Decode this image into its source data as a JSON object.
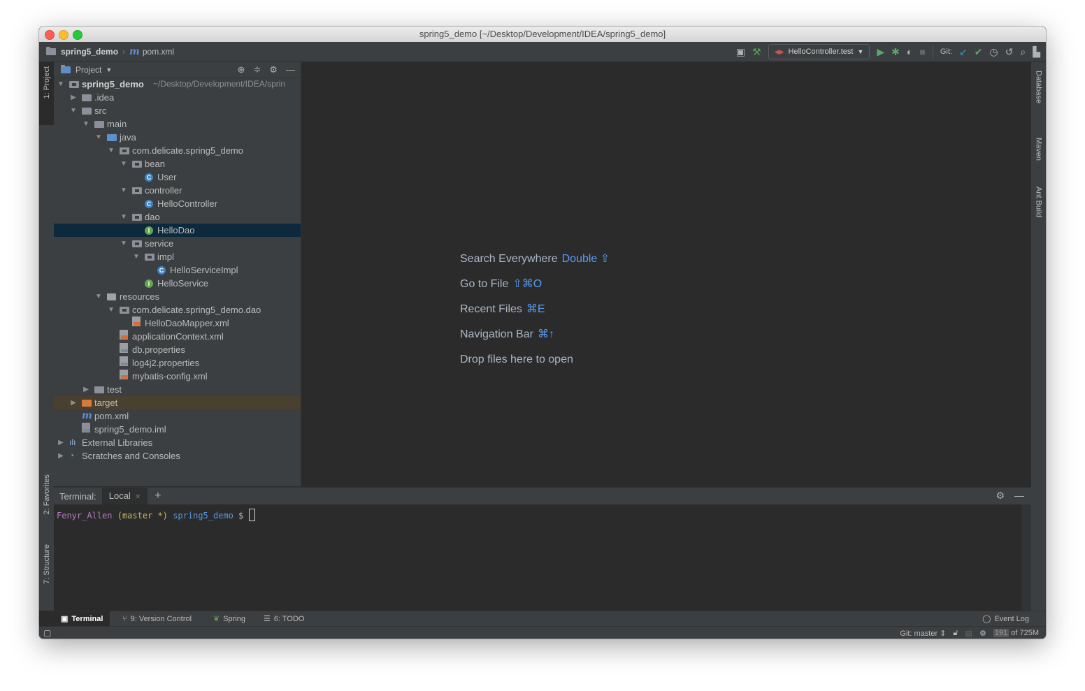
{
  "window": {
    "title": "spring5_demo [~/Desktop/Development/IDEA/spring5_demo]"
  },
  "navbar": {
    "project": "spring5_demo",
    "file": "pom.xml",
    "run_config": "HelloController.test",
    "git_label": "Git:"
  },
  "left_tabs": {
    "project": "1: Project",
    "favorites": "2: Favorites",
    "structure": "7: Structure"
  },
  "right_tabs": {
    "database": "Database",
    "maven": "Maven",
    "ant": "Ant Build"
  },
  "project_panel": {
    "title": "Project",
    "tree": [
      {
        "label": "spring5_demo",
        "path": "~/Desktop/Development/IDEA/sprin",
        "indent": 0,
        "arrow": "down",
        "icon": "module"
      },
      {
        "label": ".idea",
        "indent": 1,
        "arrow": "right",
        "icon": "folder"
      },
      {
        "label": "src",
        "indent": 1,
        "arrow": "down",
        "icon": "folder"
      },
      {
        "label": "main",
        "indent": 2,
        "arrow": "down",
        "icon": "folder"
      },
      {
        "label": "java",
        "indent": 3,
        "arrow": "down",
        "icon": "folder-blue"
      },
      {
        "label": "com.delicate.spring5_demo",
        "indent": 4,
        "arrow": "down",
        "icon": "package"
      },
      {
        "label": "bean",
        "indent": 5,
        "arrow": "down",
        "icon": "package"
      },
      {
        "label": "User",
        "indent": 6,
        "arrow": "",
        "icon": "class"
      },
      {
        "label": "controller",
        "indent": 5,
        "arrow": "down",
        "icon": "package"
      },
      {
        "label": "HelloController",
        "indent": 6,
        "arrow": "",
        "icon": "class"
      },
      {
        "label": "dao",
        "indent": 5,
        "arrow": "down",
        "icon": "package"
      },
      {
        "label": "HelloDao",
        "indent": 6,
        "arrow": "",
        "icon": "interface",
        "selected": true
      },
      {
        "label": "service",
        "indent": 5,
        "arrow": "down",
        "icon": "package"
      },
      {
        "label": "impl",
        "indent": 6,
        "arrow": "down",
        "icon": "package"
      },
      {
        "label": "HelloServiceImpl",
        "indent": 7,
        "arrow": "",
        "icon": "class"
      },
      {
        "label": "HelloService",
        "indent": 6,
        "arrow": "",
        "icon": "interface"
      },
      {
        "label": "resources",
        "indent": 3,
        "arrow": "down",
        "icon": "resources"
      },
      {
        "label": "com.delicate.spring5_demo.dao",
        "indent": 4,
        "arrow": "down",
        "icon": "package"
      },
      {
        "label": "HelloDaoMapper.xml",
        "indent": 5,
        "arrow": "",
        "icon": "xml"
      },
      {
        "label": "applicationContext.xml",
        "indent": 4,
        "arrow": "",
        "icon": "xml"
      },
      {
        "label": "db.properties",
        "indent": 4,
        "arrow": "",
        "icon": "properties"
      },
      {
        "label": "log4j2.properties",
        "indent": 4,
        "arrow": "",
        "icon": "properties"
      },
      {
        "label": "mybatis-config.xml",
        "indent": 4,
        "arrow": "",
        "icon": "xml"
      },
      {
        "label": "test",
        "indent": 2,
        "arrow": "right",
        "icon": "folder"
      },
      {
        "label": "target",
        "indent": 1,
        "arrow": "right",
        "icon": "folder-orange",
        "excluded": true
      },
      {
        "label": "pom.xml",
        "indent": 1,
        "arrow": "",
        "icon": "maven"
      },
      {
        "label": "spring5_demo.iml",
        "indent": 1,
        "arrow": "",
        "icon": "iml"
      },
      {
        "label": "External Libraries",
        "indent": 0,
        "arrow": "right",
        "icon": "libraries"
      },
      {
        "label": "Scratches and Consoles",
        "indent": 0,
        "arrow": "right",
        "icon": "scratches"
      }
    ]
  },
  "editor_hints": [
    {
      "text": "Search Everywhere",
      "key": "Double ⇧"
    },
    {
      "text": "Go to File",
      "key": "⇧⌘O"
    },
    {
      "text": "Recent Files",
      "key": "⌘E"
    },
    {
      "text": "Navigation Bar",
      "key": "⌘↑"
    },
    {
      "text": "Drop files here to open",
      "key": ""
    }
  ],
  "terminal": {
    "label": "Terminal:",
    "tab": "Local",
    "prompt_user": "Fenyr_Allen",
    "prompt_branch": "(master *)",
    "prompt_dir": "spring5_demo",
    "prompt_symbol": "$"
  },
  "bottom_tabs": [
    {
      "label": "Terminal",
      "icon": "terminal-icon"
    },
    {
      "label": "9: Version Control",
      "icon": "vcs-icon"
    },
    {
      "label": "Spring",
      "icon": "spring-icon"
    },
    {
      "label": "6: TODO",
      "icon": "todo-icon"
    }
  ],
  "event_log": "Event Log",
  "status": {
    "git": "Git: master ⇕",
    "memory_used": "191",
    "memory_total": "of 725M"
  },
  "colors": {
    "selection": "#0d293e",
    "excluded": "#4a402f",
    "accent": "#589df6"
  }
}
